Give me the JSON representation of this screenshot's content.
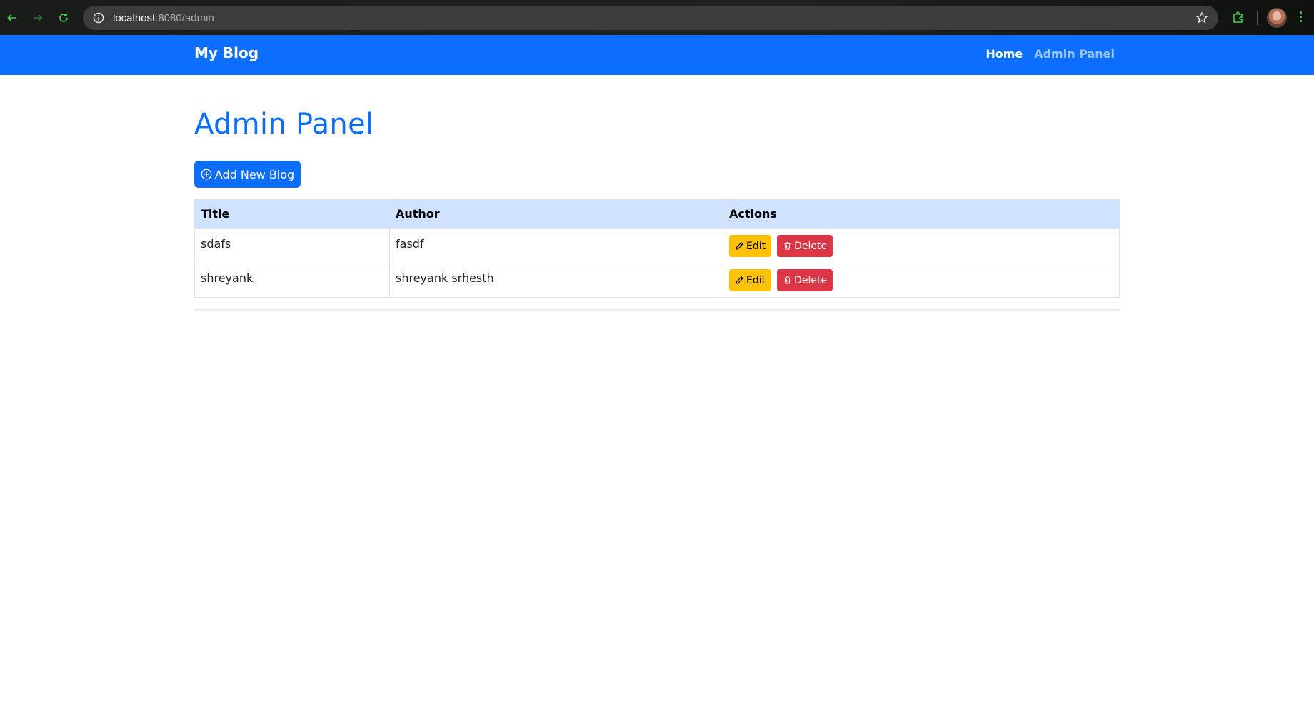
{
  "browser": {
    "url_host": "localhost",
    "url_path": ":8080/admin"
  },
  "navbar": {
    "brand": "My Blog",
    "links": [
      {
        "label": "Home"
      },
      {
        "label": "Admin Panel"
      }
    ]
  },
  "main": {
    "title": "Admin Panel",
    "add_button_label": "Add New Blog",
    "table": {
      "headers": [
        "Title",
        "Author",
        "Actions"
      ],
      "rows": [
        {
          "title": "sdafs",
          "author": "fasdf",
          "edit_label": "Edit",
          "delete_label": "Delete"
        },
        {
          "title": "shreyank",
          "author": "shreyank srhesth",
          "edit_label": "Edit",
          "delete_label": "Delete"
        }
      ]
    }
  },
  "colors": {
    "primary": "#0d6efd",
    "header_row": "#cfe2ff",
    "warning": "#ffc107",
    "danger": "#dc3545"
  }
}
